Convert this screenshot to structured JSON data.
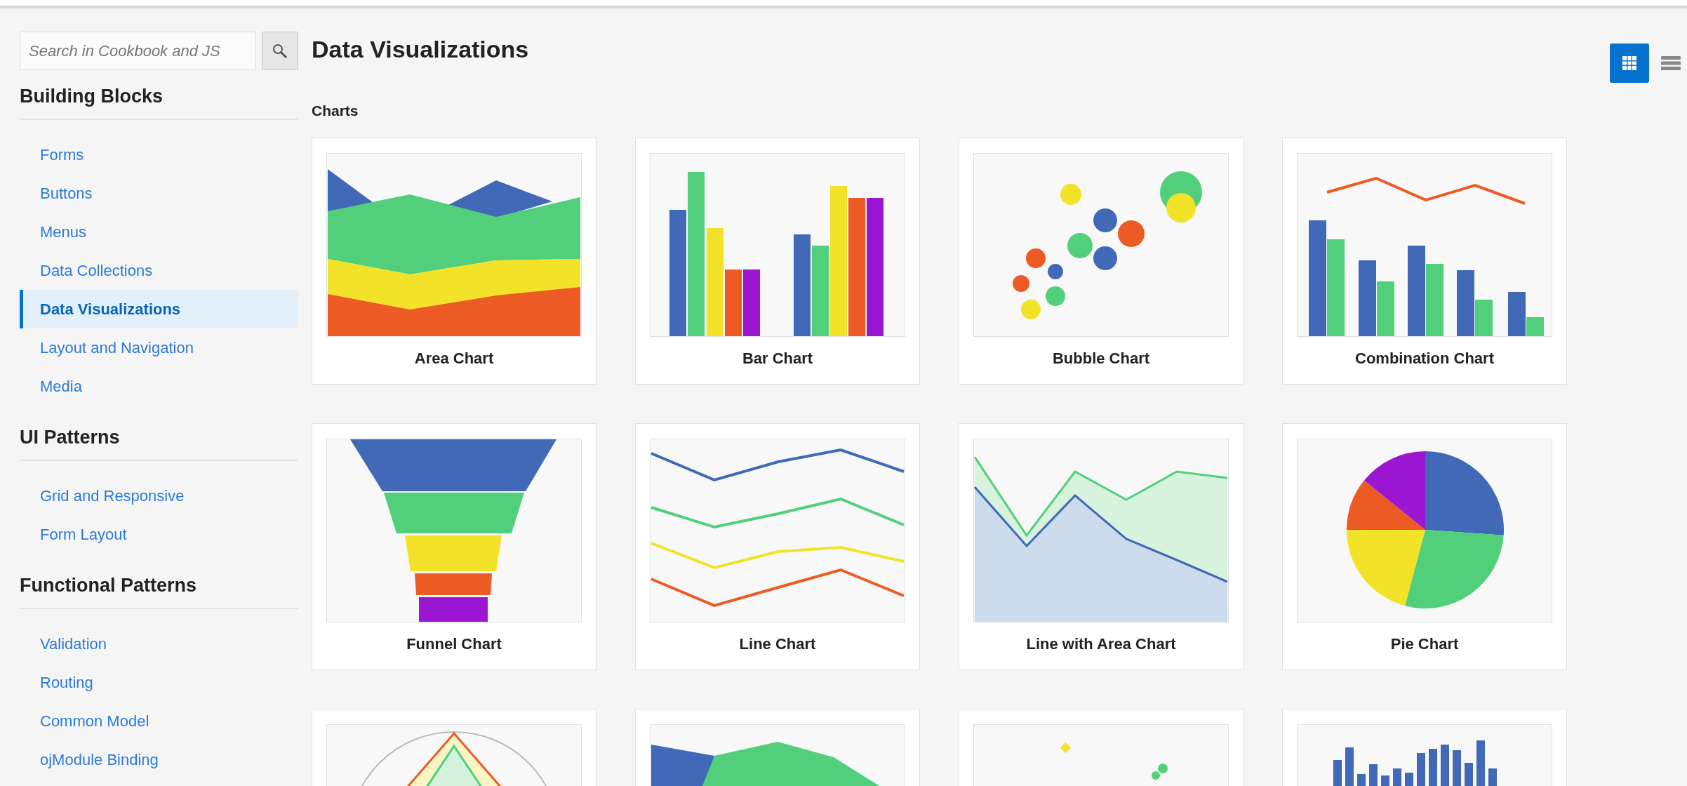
{
  "search": {
    "placeholder": "Search in Cookbook and JS"
  },
  "sidebar": {
    "sections": [
      {
        "heading": "Building Blocks",
        "items": [
          {
            "label": "Forms",
            "selected": false
          },
          {
            "label": "Buttons",
            "selected": false
          },
          {
            "label": "Menus",
            "selected": false
          },
          {
            "label": "Data Collections",
            "selected": false
          },
          {
            "label": "Data Visualizations",
            "selected": true
          },
          {
            "label": "Layout and Navigation",
            "selected": false
          },
          {
            "label": "Media",
            "selected": false
          }
        ]
      },
      {
        "heading": "UI Patterns",
        "items": [
          {
            "label": "Grid and Responsive",
            "selected": false
          },
          {
            "label": "Form Layout",
            "selected": false
          }
        ]
      },
      {
        "heading": "Functional Patterns",
        "items": [
          {
            "label": "Validation",
            "selected": false
          },
          {
            "label": "Routing",
            "selected": false
          },
          {
            "label": "Common Model",
            "selected": false
          },
          {
            "label": "ojModule Binding",
            "selected": false
          }
        ]
      }
    ]
  },
  "page_title": "Data Visualizations",
  "view_toggle": [
    {
      "kind": "grid",
      "selected": true
    },
    {
      "kind": "list",
      "selected": false
    }
  ],
  "section_title": "Charts",
  "cards": [
    {
      "kind": "area",
      "label": "Area Chart"
    },
    {
      "kind": "bar",
      "label": "Bar Chart"
    },
    {
      "kind": "bubble",
      "label": "Bubble Chart"
    },
    {
      "kind": "combination",
      "label": "Combination Chart"
    },
    {
      "kind": "funnel",
      "label": "Funnel Chart"
    },
    {
      "kind": "line",
      "label": "Line Chart"
    },
    {
      "kind": "line_area",
      "label": "Line with Area Chart"
    },
    {
      "kind": "pie",
      "label": "Pie Chart"
    },
    {
      "kind": "radar"
    },
    {
      "kind": "polygon_area"
    },
    {
      "kind": "scatter"
    },
    {
      "kind": "histogram"
    }
  ]
}
